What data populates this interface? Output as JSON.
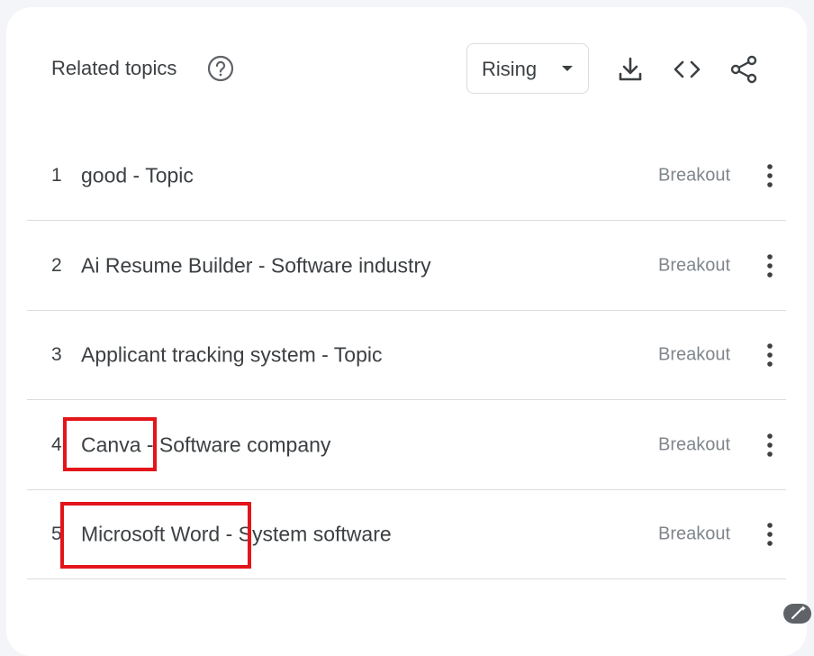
{
  "header": {
    "title": "Related topics",
    "dropdown_value": "Rising"
  },
  "icons": {
    "help": "help-circle-icon",
    "caret": "caret-down-icon",
    "download": "download-icon",
    "embed": "code-embed-icon",
    "share": "share-icon",
    "more": "more-vert-icon",
    "corner": "magic-wand-icon"
  },
  "rows": [
    {
      "rank": "1",
      "topic": "good - Topic",
      "value": "Breakout"
    },
    {
      "rank": "2",
      "topic": "Ai Resume Builder - Software industry",
      "value": "Breakout"
    },
    {
      "rank": "3",
      "topic": "Applicant tracking system - Topic",
      "value": "Breakout"
    },
    {
      "rank": "4",
      "topic": "Canva - Software company",
      "value": "Breakout"
    },
    {
      "rank": "5",
      "topic": "Microsoft Word - System software",
      "value": "Breakout"
    }
  ],
  "colors": {
    "highlight": "#e3151a",
    "text": "#3c4043",
    "muted": "#80868b",
    "divider": "#dadce0"
  }
}
